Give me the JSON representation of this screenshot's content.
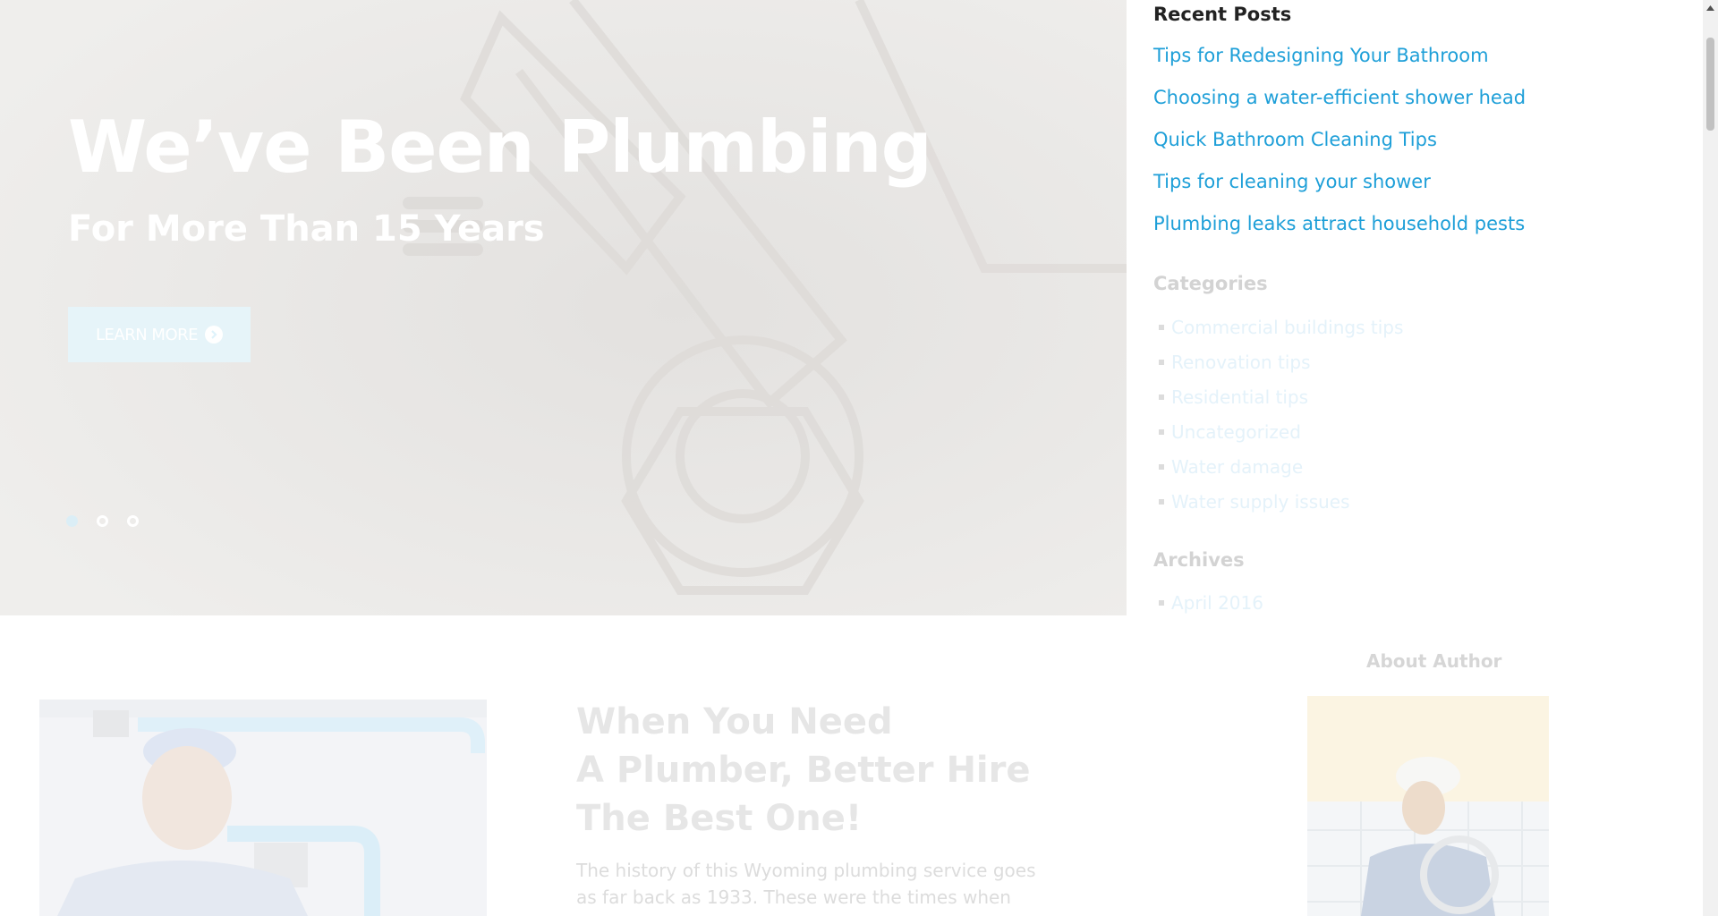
{
  "hero": {
    "title": "We’ve Been Plumbing",
    "subtitle": "For More Than 15 Years",
    "button_label": "LEARN MORE",
    "slides": {
      "count": 3,
      "active_index": 0
    }
  },
  "sidebar": {
    "recent_posts": {
      "title": "Recent Posts",
      "items": [
        "Tips for Redesigning Your Bathroom",
        "Choosing a water-efficient shower head",
        "Quick Bathroom Cleaning Tips",
        "Tips for cleaning your shower",
        "Plumbing leaks attract household pests"
      ]
    },
    "categories": {
      "title": "Categories",
      "items": [
        "Commercial buildings tips",
        "Renovation tips",
        "Residential tips",
        "Uncategorized",
        "Water damage",
        "Water supply issues"
      ]
    },
    "archives": {
      "title": "Archives",
      "items": [
        "April 2016"
      ]
    },
    "about_author": {
      "title": "About Author"
    }
  },
  "content": {
    "heading_lines": [
      "When You Need",
      "A Plumber, Better Hire",
      "The Best One!"
    ],
    "body_lines": [
      "The history of this Wyoming plumbing service goes",
      "as far back as 1933. These were the times when"
    ]
  },
  "colors": {
    "link": "#1e9fd8",
    "heading_dark": "#222222",
    "faded_text": "#d3d3d3"
  }
}
